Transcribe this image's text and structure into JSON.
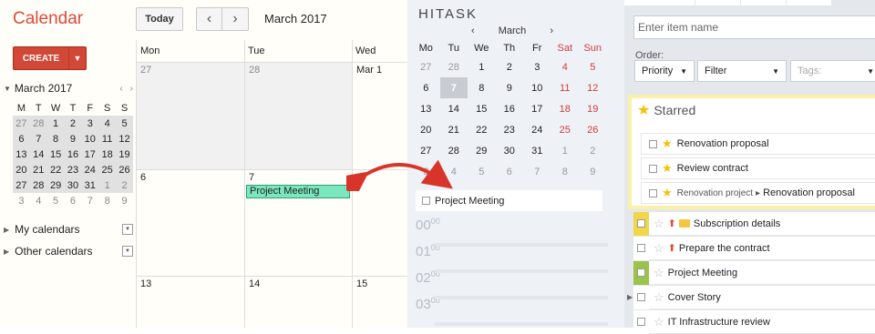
{
  "gcal": {
    "title": "Calendar",
    "today_label": "Today",
    "prev_icon": "‹",
    "next_icon": "›",
    "range": "March 2017",
    "create_label": "CREATE",
    "mini": {
      "month": "March 2017",
      "dow": [
        "M",
        "T",
        "W",
        "T",
        "F",
        "S",
        "S"
      ],
      "weeks": [
        [
          "27",
          "28",
          "1",
          "2",
          "3",
          "4",
          "5"
        ],
        [
          "6",
          "7",
          "8",
          "9",
          "10",
          "11",
          "12"
        ],
        [
          "13",
          "14",
          "15",
          "16",
          "17",
          "18",
          "19"
        ],
        [
          "20",
          "21",
          "22",
          "23",
          "24",
          "25",
          "26"
        ],
        [
          "27",
          "28",
          "29",
          "30",
          "31",
          "1",
          "2"
        ],
        [
          "3",
          "4",
          "5",
          "6",
          "7",
          "8",
          "9"
        ]
      ]
    },
    "my_calendars": "My calendars",
    "other_calendars": "Other calendars",
    "week_days": [
      "Mon",
      "Tue",
      "Wed"
    ],
    "cells": {
      "r1": [
        "27",
        "28",
        "Mar 1"
      ],
      "r2": [
        "6",
        "7"
      ],
      "r3": [
        "13",
        "14",
        "15"
      ]
    },
    "event": "Project Meeting"
  },
  "hitask": {
    "logo": "HITASK",
    "month": "March",
    "prev_icon": "‹",
    "next_icon": "›",
    "dow": [
      "Mo",
      "Tu",
      "We",
      "Th",
      "Fr",
      "Sat",
      "Sun"
    ],
    "weeks": [
      [
        "27",
        "28",
        "1",
        "2",
        "3",
        "4",
        "5"
      ],
      [
        "6",
        "7",
        "8",
        "9",
        "10",
        "11",
        "12"
      ],
      [
        "13",
        "14",
        "15",
        "16",
        "17",
        "18",
        "19"
      ],
      [
        "20",
        "21",
        "22",
        "23",
        "24",
        "25",
        "26"
      ],
      [
        "27",
        "28",
        "29",
        "30",
        "31",
        "1",
        "2"
      ],
      [
        "3",
        "4",
        "5",
        "6",
        "7",
        "8",
        "9"
      ]
    ],
    "task": "Project Meeting",
    "hours": [
      "00",
      "01",
      "02",
      "03"
    ],
    "hour_sup": "00"
  },
  "list": {
    "search_placeholder": "Enter item name",
    "order_label": "Order:",
    "priority": "Priority",
    "filter": "Filter",
    "tags_placeholder": "Tags:",
    "starred": "Starred",
    "starred_items": [
      {
        "text": "Renovation proposal",
        "project": ""
      },
      {
        "text": "Review contract",
        "project": ""
      },
      {
        "text": "Renovation proposal",
        "project": "Renovation project"
      }
    ],
    "items": [
      {
        "text": "Subscription details",
        "color": "#f2d649"
      },
      {
        "text": "Prepare the contract",
        "color": "#ffffff"
      },
      {
        "text": "Project Meeting",
        "color": "#9ac34a"
      },
      {
        "text": "Cover Story",
        "color": "#ffffff"
      },
      {
        "text": "IT Infrastructure review",
        "color": "#ffffff"
      }
    ]
  },
  "colors": {
    "brand_red": "#dd4b39",
    "event_green": "#7ae7bf",
    "weekend_red": "#d43a3a",
    "starred_border": "#fbf0a8"
  }
}
